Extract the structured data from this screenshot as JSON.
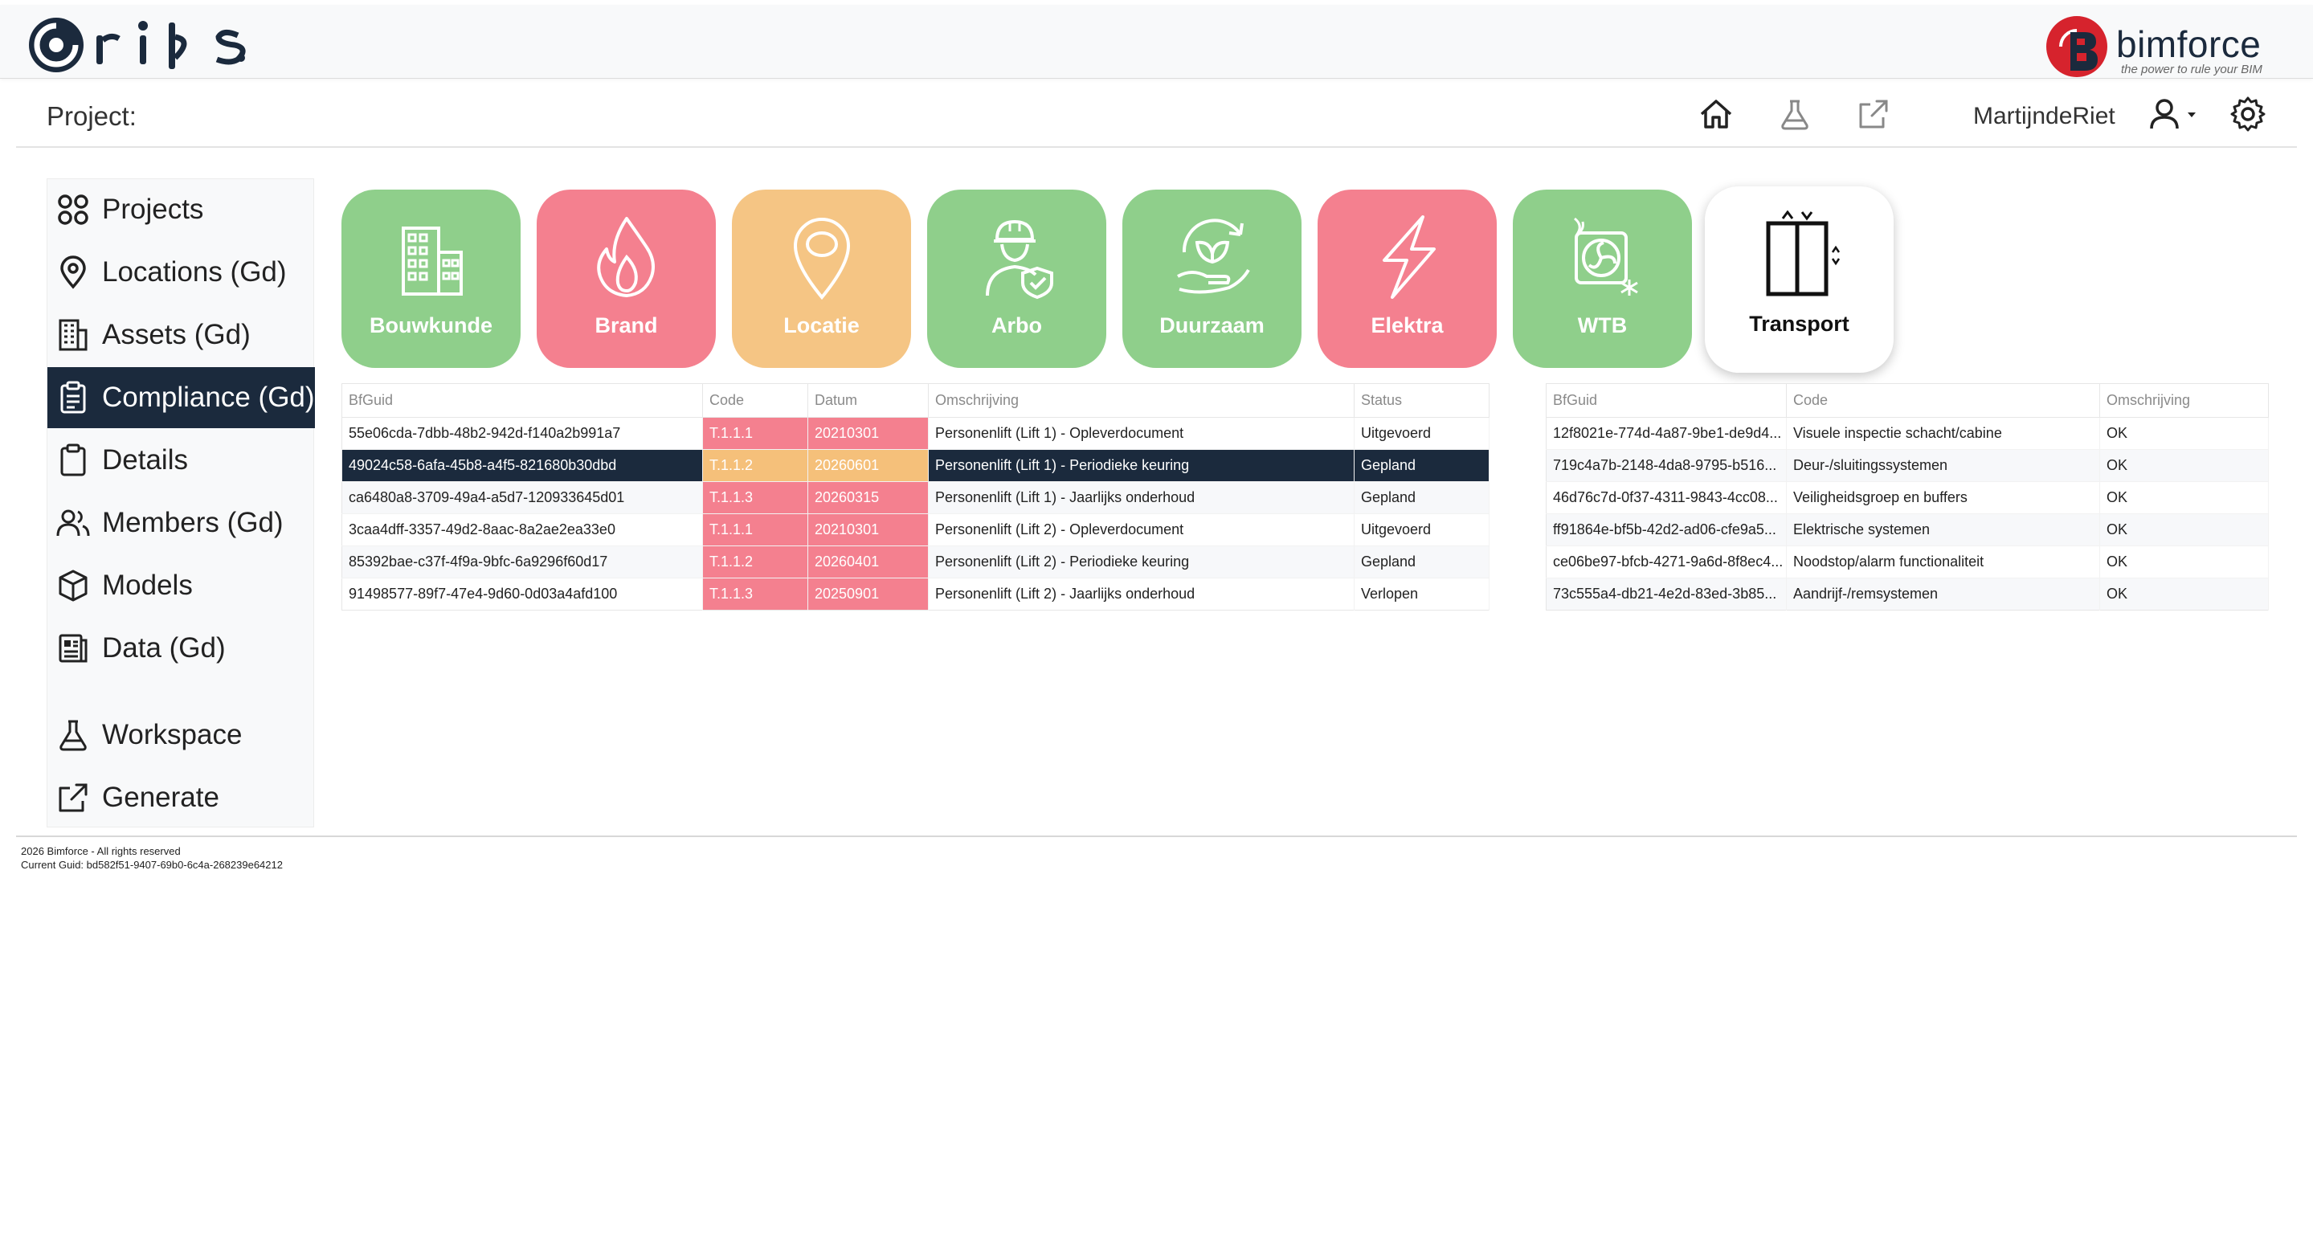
{
  "brand": {
    "app_name": "rips",
    "company": "bimforce",
    "tagline": "the power to rule your BIM"
  },
  "header": {
    "project_label": "Project:",
    "username": "MartijndeRiet",
    "icons": [
      "home-icon",
      "flask-icon",
      "external-link-icon",
      "user-icon",
      "gear-icon"
    ]
  },
  "sidebar": {
    "items": [
      {
        "label": "Projects",
        "icon": "grid-icon"
      },
      {
        "label": "Locations (Gd)",
        "icon": "location-pin-icon"
      },
      {
        "label": "Assets (Gd)",
        "icon": "building-icon"
      },
      {
        "label": "Compliance (Gd)",
        "icon": "clipboard-check-icon",
        "active": true
      },
      {
        "label": "Details",
        "icon": "clipboard-icon"
      },
      {
        "label": "Members (Gd)",
        "icon": "users-icon"
      },
      {
        "label": "Models",
        "icon": "cube-icon"
      },
      {
        "label": "Data (Gd)",
        "icon": "data-icon"
      },
      {
        "label": "Workspace",
        "icon": "flask-icon"
      },
      {
        "label": "Generate",
        "icon": "external-link-icon"
      }
    ]
  },
  "categories": [
    {
      "label": "Bouwkunde",
      "icon": "building-icon",
      "color": "#8fcf8b"
    },
    {
      "label": "Brand",
      "icon": "fire-icon",
      "color": "#f4808f"
    },
    {
      "label": "Locatie",
      "icon": "location-pin-icon",
      "color": "#f5c584"
    },
    {
      "label": "Arbo",
      "icon": "worker-icon",
      "color": "#8fcf8b"
    },
    {
      "label": "Duurzaam",
      "icon": "leaf-hand-icon",
      "color": "#8fcf8b"
    },
    {
      "label": "Elektra",
      "icon": "lightning-icon",
      "color": "#f4808f"
    },
    {
      "label": "WTB",
      "icon": "fan-icon",
      "color": "#8fcf8b"
    },
    {
      "label": "Transport",
      "icon": "elevator-icon",
      "color": "#ffffff",
      "selected": true
    }
  ],
  "compliance_table": {
    "columns": [
      "BfGuid",
      "Code",
      "Datum",
      "Omschrijving",
      "Status"
    ],
    "rows": [
      {
        "guid": "55e06cda-7dbb-48b2-942d-f140a2b991a7",
        "code": "T.1.1.1",
        "datum": "20210301",
        "omschrijving": "Personenlift (Lift 1) - Opleverdocument",
        "status": "Uitgevoerd",
        "code_color": "red",
        "datum_color": "red"
      },
      {
        "guid": "49024c58-6afa-45b8-a4f5-821680b30dbd",
        "code": "T.1.1.2",
        "datum": "20260601",
        "omschrijving": "Personenlift (Lift 1) - Periodieke keuring",
        "status": "Gepland",
        "code_color": "amber",
        "datum_color": "amber",
        "selected": true
      },
      {
        "guid": "ca6480a8-3709-49a4-a5d7-120933645d01",
        "code": "T.1.1.3",
        "datum": "20260315",
        "omschrijving": "Personenlift (Lift 1) - Jaarlijks onderhoud",
        "status": "Gepland",
        "code_color": "red",
        "datum_color": "red"
      },
      {
        "guid": "3caa4dff-3357-49d2-8aac-8a2ae2ea33e0",
        "code": "T.1.1.1",
        "datum": "20210301",
        "omschrijving": "Personenlift (Lift 2) - Opleverdocument",
        "status": "Uitgevoerd",
        "code_color": "red",
        "datum_color": "red"
      },
      {
        "guid": "85392bae-c37f-4f9a-9bfc-6a9296f60d17",
        "code": "T.1.1.2",
        "datum": "20260401",
        "omschrijving": "Personenlift (Lift 2) - Periodieke keuring",
        "status": "Gepland",
        "code_color": "red",
        "datum_color": "red"
      },
      {
        "guid": "91498577-89f7-47e4-9d60-0d03a4afd100",
        "code": "T.1.1.3",
        "datum": "20250901",
        "omschrijving": "Personenlift (Lift 2) - Jaarlijks onderhoud",
        "status": "Verlopen",
        "code_color": "red",
        "datum_color": "red"
      }
    ]
  },
  "details_table": {
    "columns": [
      "BfGuid",
      "Code",
      "Omschrijving"
    ],
    "rows": [
      {
        "guid": "12f8021e-774d-4a87-9be1-de9d4...",
        "code": "Visuele inspectie schacht/cabine",
        "omschrijving": "OK"
      },
      {
        "guid": "719c4a7b-2148-4da8-9795-b516...",
        "code": "Deur-/sluitingssystemen",
        "omschrijving": "OK"
      },
      {
        "guid": "46d76c7d-0f37-4311-9843-4cc08...",
        "code": "Veiligheidsgroep en buffers",
        "omschrijving": "OK"
      },
      {
        "guid": "ff91864e-bf5b-42d2-ad06-cfe9a5...",
        "code": "Elektrische systemen",
        "omschrijving": "OK"
      },
      {
        "guid": "ce06be97-bfcb-4271-9a6d-8f8ec4...",
        "code": "Noodstop/alarm functionaliteit",
        "omschrijving": "OK"
      },
      {
        "guid": "73c555a4-db21-4e2d-83ed-3b85...",
        "code": "Aandrijf-/remsystemen",
        "omschrijving": "OK"
      }
    ]
  },
  "footer": {
    "copyright": "2026 Bimforce - All rights reserved",
    "current_guid": "Current Guid: bd582f51-9407-69b0-6c4a-268239e64212"
  }
}
